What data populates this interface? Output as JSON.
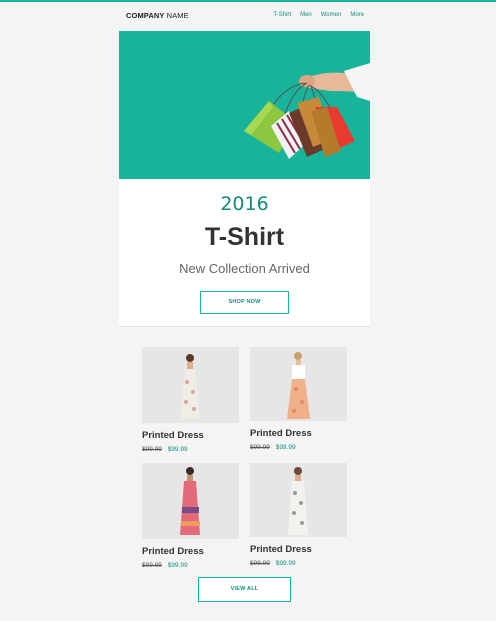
{
  "header": {
    "brand_bold": "COMPANY",
    "brand_rest": "NAME",
    "nav": [
      "T-Shirt",
      "Men",
      "Women",
      "More"
    ]
  },
  "hero": {
    "year": "2016",
    "title": "T-Shirt",
    "subtitle": "New Collection Arrived",
    "shop_button": "SHOP NOW"
  },
  "products": [
    {
      "name": "Printed Dress",
      "old_price": "$99.99",
      "new_price": "$99.99"
    },
    {
      "name": "Printed Dress",
      "old_price": "$99.99",
      "new_price": "$99.99"
    },
    {
      "name": "Printed Dress",
      "old_price": "$99.99",
      "new_price": "$99.99"
    },
    {
      "name": "Printed Dress",
      "old_price": "$99.99",
      "new_price": "$99.99"
    }
  ],
  "view_all_button": "VIEW ALL",
  "colors": {
    "accent": "#17b39b",
    "accent_text": "#138e7d"
  }
}
